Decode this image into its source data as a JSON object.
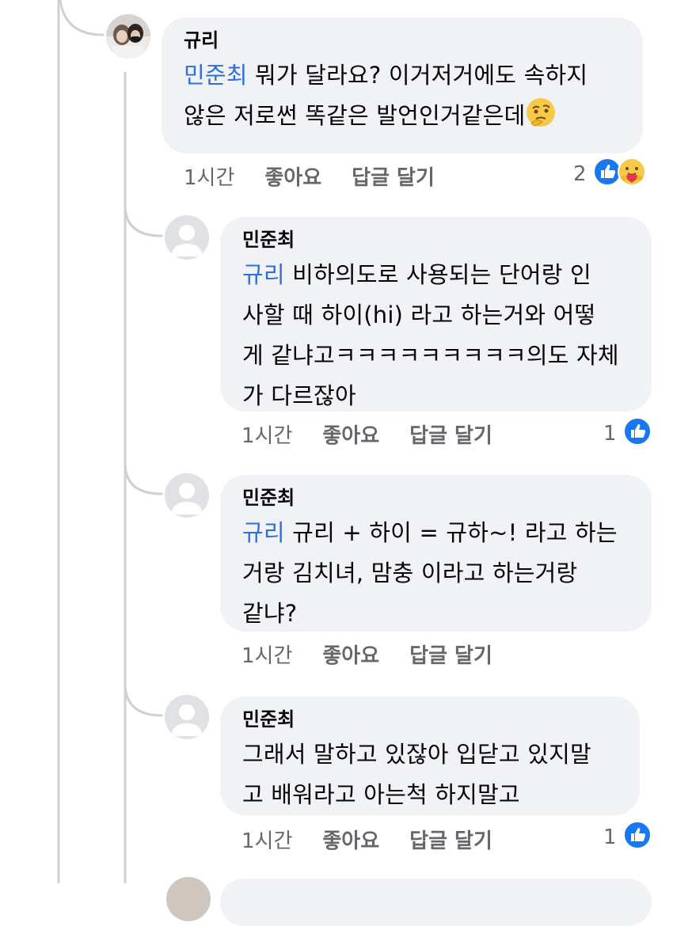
{
  "comments": [
    {
      "author": "규리",
      "mention": "민준최",
      "text_line1": " 뭐가 달라요? 이거저거에도 속하지",
      "text_line2": "않은 저로썬 똑같은 발언인거같은데",
      "time": "1시간",
      "like_label": "좋아요",
      "reply_label": "답글 달기",
      "reaction_count": "2",
      "reactions": [
        "thumbs-up-icon",
        "care-hug-icon"
      ],
      "inline_emoji": "thinking-face-icon"
    },
    {
      "author": "민준최",
      "mention": "규리",
      "text_line1": " 비하의도로 사용되는 단어랑 인",
      "text_line2": "사할 때 하이(hi) 라고 하는거와 어떻",
      "text_line3": "게 같냐고ㅋㅋㅋㅋㅋㅋㅋㅋㅋ의도 자체",
      "text_line4": "가  다르잖아",
      "time": "1시간",
      "like_label": "좋아요",
      "reply_label": "답글 달기",
      "reaction_count": "1",
      "reactions": [
        "thumbs-up-icon"
      ]
    },
    {
      "author": "민준최",
      "mention": "규리",
      "text_line1": " 규리 + 하이 = 규하~! 라고 하는",
      "text_line2": "거랑 김치녀, 맘충 이라고 하는거랑",
      "text_line3": "같냐?",
      "time": "1시간",
      "like_label": "좋아요",
      "reply_label": "답글 달기"
    },
    {
      "author": "민준최",
      "text_line1": "그래서 말하고 있잖아 입닫고 있지말",
      "text_line2": "고 배워라고 아는척 하지말고",
      "time": "1시간",
      "like_label": "좋아요",
      "reply_label": "답글 달기",
      "reaction_count": "1",
      "reactions": [
        "thumbs-up-icon"
      ]
    }
  ],
  "colors": {
    "mention": "#2e6fdc",
    "bubble": "#f0f2f5",
    "meta_text": "#65676b",
    "like_blue": "#1877f2",
    "thread_line": "#ced0d4"
  }
}
